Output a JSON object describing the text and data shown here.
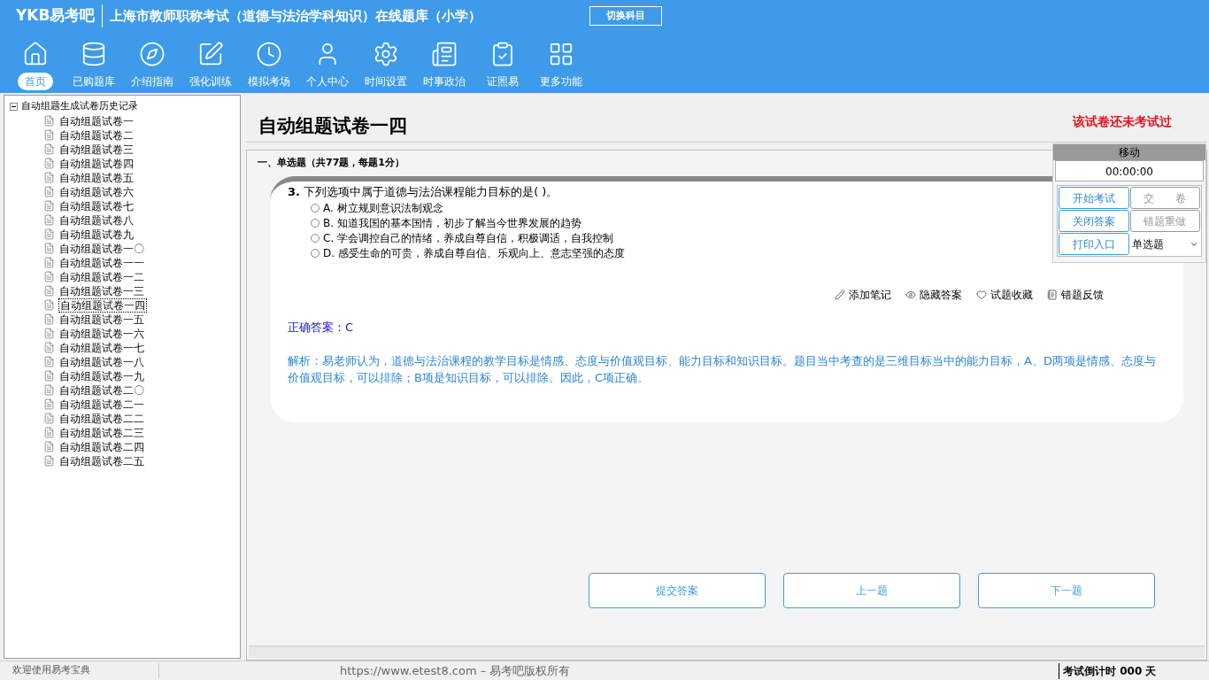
{
  "header": {
    "logo": "YKB易考吧",
    "title": "上海市教师职称考试（道德与法治学科知识）在线题库（小学）",
    "switch_button": "切换科目"
  },
  "nav": [
    {
      "label": "首页",
      "selected": true
    },
    {
      "label": "已购题库",
      "selected": false
    },
    {
      "label": "介绍指南",
      "selected": false
    },
    {
      "label": "强化训练",
      "selected": false
    },
    {
      "label": "模拟考场",
      "selected": false
    },
    {
      "label": "个人中心",
      "selected": false
    },
    {
      "label": "时间设置",
      "selected": false
    },
    {
      "label": "时事政治",
      "selected": false
    },
    {
      "label": "证照易",
      "selected": false
    },
    {
      "label": "更多功能",
      "selected": false
    }
  ],
  "tree": {
    "label": "自动组题生成试卷历史记录",
    "expanded": true,
    "children": [
      {
        "label": "自动组题试卷一",
        "selected": false
      },
      {
        "label": "自动组题试卷二",
        "selected": false
      },
      {
        "label": "自动组题试卷三",
        "selected": false
      },
      {
        "label": "自动组题试卷四",
        "selected": false
      },
      {
        "label": "自动组题试卷五",
        "selected": false
      },
      {
        "label": "自动组题试卷六",
        "selected": false
      },
      {
        "label": "自动组题试卷七",
        "selected": false
      },
      {
        "label": "自动组题试卷八",
        "selected": false
      },
      {
        "label": "自动组题试卷九",
        "selected": false
      },
      {
        "label": "自动组题试卷一〇",
        "selected": false
      },
      {
        "label": "自动组题试卷一一",
        "selected": false
      },
      {
        "label": "自动组题试卷一二",
        "selected": false
      },
      {
        "label": "自动组题试卷一三",
        "selected": false
      },
      {
        "label": "自动组题试卷一四",
        "selected": true
      },
      {
        "label": "自动组题试卷一五",
        "selected": false
      },
      {
        "label": "自动组题试卷一六",
        "selected": false
      },
      {
        "label": "自动组题试卷一七",
        "selected": false
      },
      {
        "label": "自动组题试卷一八",
        "selected": false
      },
      {
        "label": "自动组题试卷一九",
        "selected": false
      },
      {
        "label": "自动组题试卷二〇",
        "selected": false
      },
      {
        "label": "自动组题试卷二一",
        "selected": false
      },
      {
        "label": "自动组题试卷二二",
        "selected": false
      },
      {
        "label": "自动组题试卷二三",
        "selected": false
      },
      {
        "label": "自动组题试卷二四",
        "selected": false
      },
      {
        "label": "自动组题试卷二五",
        "selected": false
      }
    ]
  },
  "paper": {
    "title": "自动组题试卷一四",
    "status": "该试卷还未考试过",
    "section": "一、单选题（共77题，每题1分）"
  },
  "question": {
    "number": "3.",
    "text": "下列选项中属于道德与法治课程能力目标的是( )。",
    "options": [
      {
        "label": "A.",
        "text": "树立规则意识法制观念",
        "selected": false
      },
      {
        "label": "B.",
        "text": "知道我国的基本国情，初步了解当今世界发展的趋势",
        "selected": false
      },
      {
        "label": "C.",
        "text": "学会调控自己的情绪，养成自尊自信，积极调适，自我控制",
        "selected": false
      },
      {
        "label": "D.",
        "text": "感受生命的可贵，养成自尊自信、乐观向上、意志坚强的态度",
        "selected": false
      }
    ],
    "actions": [
      "添加笔记",
      "隐藏答案",
      "试题收藏",
      "错题反馈"
    ],
    "answer": "正确答案：C",
    "analysis": "解析：易老师认为，道德与法治课程的教学目标是情感、态度与价值观目标、能力目标和知识目标。题目当中考查的是三维目标当中的能力目标，A、D两项是情感、态度与价值观目标，可以排除；B项是知识目标，可以排除。因此，C项正确。"
  },
  "panel": {
    "title": "移动",
    "timer": "00:00:00",
    "buttons": [
      {
        "label": "开始考试",
        "disabled": false
      },
      {
        "label": "交　　卷",
        "disabled": true
      },
      {
        "label": "关闭答案",
        "disabled": false
      },
      {
        "label": "错题重做",
        "disabled": true
      },
      {
        "label": "打印入口",
        "disabled": false
      }
    ],
    "select": "单选题"
  },
  "bottom_buttons": [
    "提交答案",
    "上一题",
    "下一题"
  ],
  "status_bar": {
    "welcome": "欢迎使用易考宝典",
    "copyright": "https://www.etest8.com – 易考吧版权所有",
    "countdown": "考试倒计时 000 天"
  }
}
